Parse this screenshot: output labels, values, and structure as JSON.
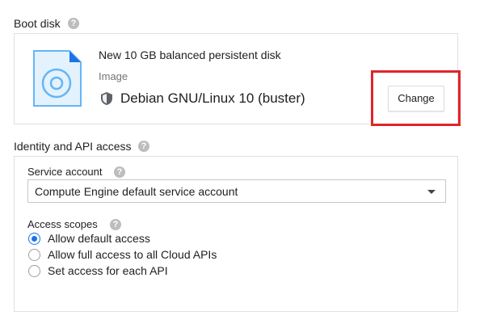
{
  "boot_disk": {
    "title": "Boot disk",
    "disk_name": "New 10 GB balanced persistent disk",
    "type_label": "Image",
    "os_name": "Debian GNU/Linux 10 (buster)",
    "change_label": "Change",
    "highlight_color": "#e0242b",
    "icon": "disk-icon"
  },
  "identity": {
    "title": "Identity and API access",
    "service_account_label": "Service account",
    "service_account_value": "Compute Engine default service account",
    "access_scopes_label": "Access scopes",
    "scopes": [
      {
        "label": "Allow default access",
        "checked": true
      },
      {
        "label": "Allow full access to all Cloud APIs",
        "checked": false
      },
      {
        "label": "Set access for each API",
        "checked": false
      }
    ]
  },
  "colors": {
    "accent": "#1a73e8",
    "border": "#e0e0e0",
    "disk_icon_fill": "#e3f2fd",
    "disk_icon_stroke": "#64b5f6"
  }
}
